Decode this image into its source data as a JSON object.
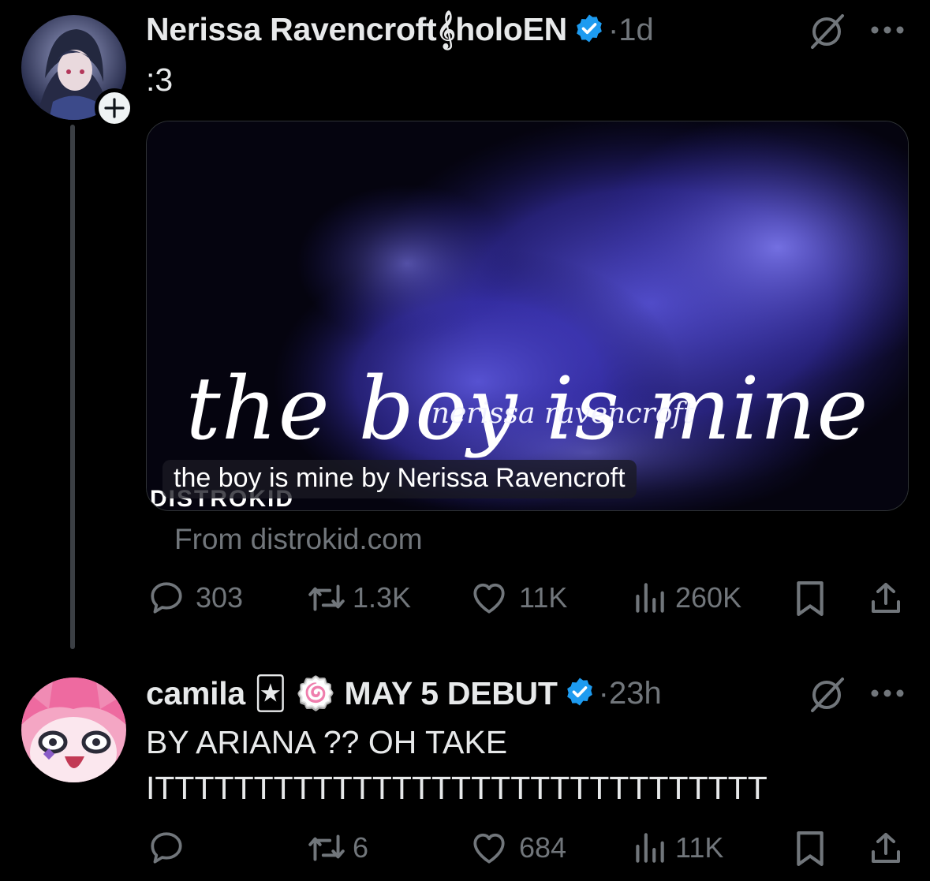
{
  "posts": [
    {
      "author": "Nerissa Ravencroft𝄞holoEN",
      "sep": "·",
      "time": "1d",
      "text": ":3",
      "card": {
        "title": "the boy is mine",
        "subtitle": "nerissa ravencroft",
        "brand": "DISTROKID",
        "caption": "the boy is mine by Nerissa Ravencroft",
        "domain": "From distrokid.com"
      },
      "actions": {
        "replies": "303",
        "reposts": "1.3K",
        "likes": "11K",
        "views": "260K"
      }
    },
    {
      "author": "camila 🃏 🍥 MAY 5 DEBUT",
      "sep": "·",
      "time": "23h",
      "text_line1": "BY ARIANA ?? OH TAKE",
      "text_line2": "ITTTTTTTTTTTTTTTTTTTTTTTTTTTTTTT",
      "actions": {
        "replies": "",
        "reposts": "6",
        "likes": "684",
        "views": "11K"
      }
    }
  ],
  "colors": {
    "verified": "#1d9bf0",
    "muted": "#71767b",
    "text": "#e7e9ea",
    "background": "#000000"
  }
}
